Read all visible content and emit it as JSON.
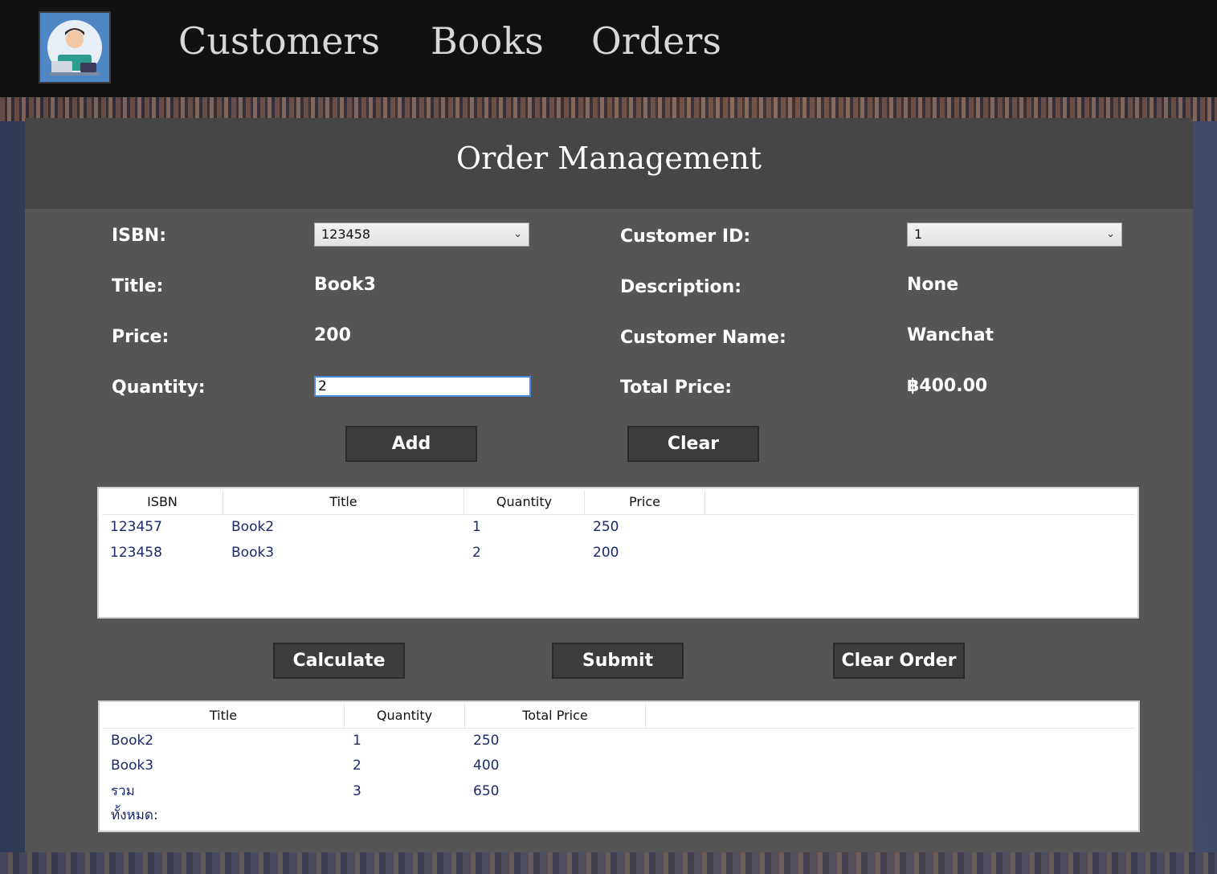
{
  "nav": {
    "items": [
      "Customers",
      "Books",
      "Orders"
    ]
  },
  "panel": {
    "title": "Order Management"
  },
  "form": {
    "isbn_label": "ISBN:",
    "isbn_value": "123458",
    "title_label": "Title:",
    "title_value": "Book3",
    "price_label": "Price:",
    "price_value": "200",
    "quantity_label": "Quantity:",
    "quantity_value": "2",
    "customer_id_label": "Customer ID:",
    "customer_id_value": "1",
    "description_label": "Description:",
    "description_value": "None",
    "customer_name_label": "Customer Name:",
    "customer_name_value": "Wanchat",
    "total_price_label": "Total Price:",
    "total_price_value": "฿400.00"
  },
  "buttons": {
    "add": "Add",
    "clear": "Clear",
    "calculate": "Calculate",
    "submit": "Submit",
    "clear_order": "Clear Order"
  },
  "items_table": {
    "headers": [
      "ISBN",
      "Title",
      "Quantity",
      "Price"
    ],
    "rows": [
      [
        "123457",
        "Book2",
        "1",
        "250"
      ],
      [
        "123458",
        "Book3",
        "2",
        "200"
      ]
    ]
  },
  "summary_table": {
    "headers": [
      "Title",
      "Quantity",
      "Total Price"
    ],
    "rows": [
      [
        "Book2",
        "1",
        "250"
      ],
      [
        "Book3",
        "2",
        "400"
      ],
      [
        "รวมทั้งหมด:",
        "3",
        "650"
      ]
    ]
  },
  "icons": {
    "chevron": "chevron-down-icon",
    "logo": "developer-avatar-logo"
  }
}
